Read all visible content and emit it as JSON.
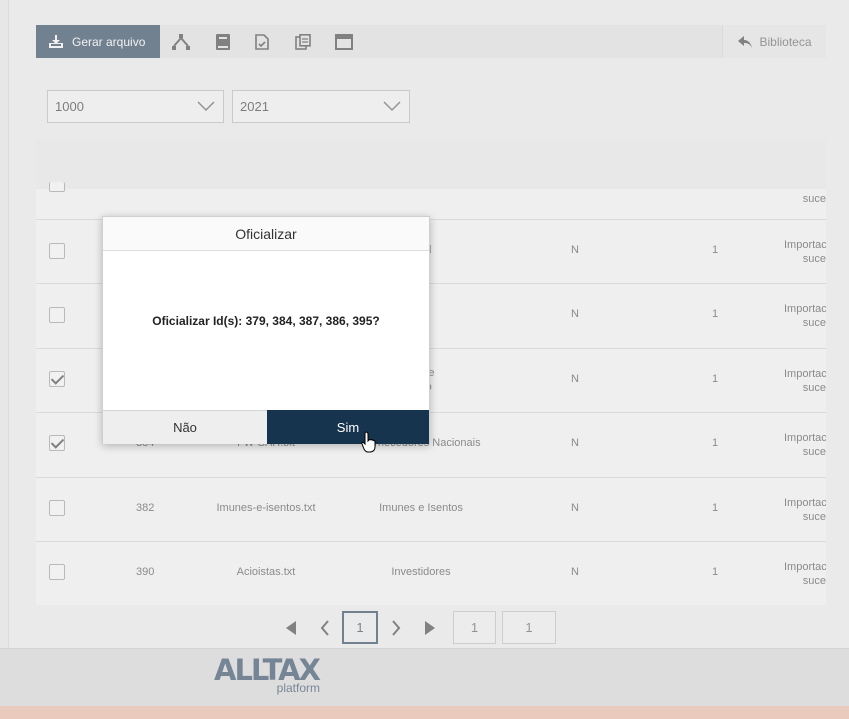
{
  "toolbar": {
    "generate_label": "Gerar arquivo",
    "library_label": "Biblioteca",
    "icons": [
      "hierarchy-icon",
      "book-icon",
      "file-check-icon",
      "copy-icon",
      "window-icon"
    ]
  },
  "filters": {
    "first_value": "1000",
    "second_value": "2021"
  },
  "table": {
    "rows": [
      {
        "id": "",
        "file": "",
        "desc": "",
        "flag": "",
        "count": "",
        "status1": "",
        "status2": "suce",
        "checked": false
      },
      {
        "id": "",
        "file": "",
        "desc": "onal",
        "flag": "N",
        "count": "1",
        "status1": "Importac",
        "status2": "suce",
        "checked": false
      },
      {
        "id": "",
        "file": "",
        "desc": "A",
        "flag": "N",
        "count": "1",
        "status1": "Importac",
        "status2": "suce",
        "checked": false
      },
      {
        "id": "",
        "file": "",
        "desc": "itê de\nento",
        "flag": "N",
        "count": "1",
        "status1": "Importac",
        "status2": "suce",
        "checked": true
      },
      {
        "id": "384",
        "file": "FW-SAH.txt",
        "desc": "Fornecedores Nacionais",
        "flag": "N",
        "count": "1",
        "status1": "Importac",
        "status2": "suce",
        "checked": true
      },
      {
        "id": "382",
        "file": "Imunes-e-isentos.txt",
        "desc": "Imunes e Isentos",
        "flag": "N",
        "count": "1",
        "status1": "Importac",
        "status2": "suce",
        "checked": false
      },
      {
        "id": "390",
        "file": "Acioistas.txt",
        "desc": "Investidores",
        "flag": "N",
        "count": "1",
        "status1": "Importac",
        "status2": "suce",
        "checked": false
      }
    ]
  },
  "pagination": {
    "current_page": "1",
    "page_input": "1",
    "total_pages": "1"
  },
  "footer": {
    "logo_text": "ALLTAX",
    "logo_sub": "platform"
  },
  "modal": {
    "title": "Oficializar",
    "message": "Oficializar Id(s): 379, 384, 387, 386, 395?",
    "no_label": "Não",
    "yes_label": "Sim"
  },
  "colors": {
    "primary": "#17344f",
    "footer_bar": "#f4b9a3"
  }
}
